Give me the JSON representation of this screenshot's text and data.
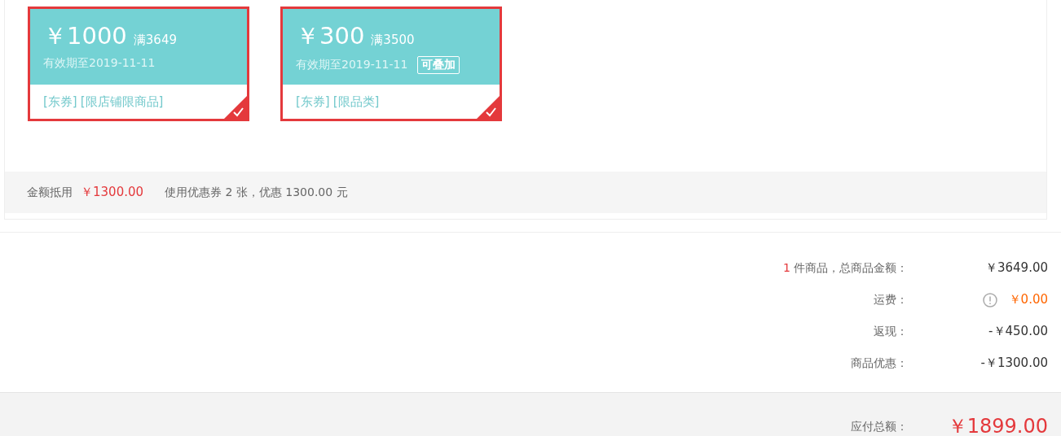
{
  "coupons": [
    {
      "amount": "￥1000",
      "condition": "满3649",
      "validity": "有效期至2019-11-11",
      "stackable": false,
      "tags": [
        "[东券]",
        "[限店铺限商品]"
      ],
      "selected": true
    },
    {
      "amount": "￥300",
      "condition": "满3500",
      "validity": "有效期至2019-11-11",
      "stackable": true,
      "stack_label": "可叠加",
      "tags": [
        "[东券]",
        "[限品类]"
      ],
      "selected": true
    }
  ],
  "coupon_summary": {
    "label": "金额抵用",
    "amount": "￥1300.00",
    "text": "使用优惠券 2 张，优惠 1300.00 元"
  },
  "totals": [
    {
      "kind": "items",
      "count": "1",
      "label": "件商品，总商品金额：",
      "value": "￥3649.00"
    },
    {
      "kind": "shipping",
      "label": "运费：",
      "value": "￥0.00"
    },
    {
      "kind": "plain",
      "label": "返现：",
      "value": "-￥450.00"
    },
    {
      "kind": "plain",
      "label": "商品优惠：",
      "value": "-￥1300.00"
    }
  ],
  "payable": {
    "label": "应付总额：",
    "value": "￥1899.00"
  }
}
